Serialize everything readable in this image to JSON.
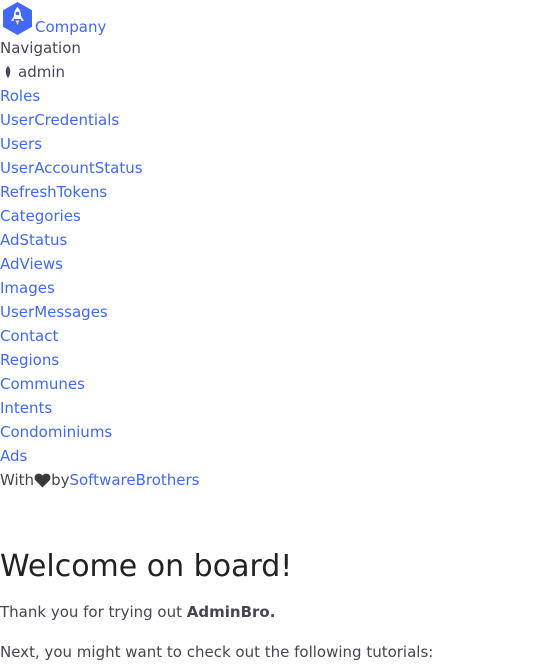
{
  "brand": {
    "logo_icon": "rocket-icon",
    "name": "Company"
  },
  "nav": {
    "heading": "Navigation",
    "group": {
      "icon": "leaf-icon",
      "label": "admin"
    },
    "items": [
      "Roles",
      "UserCredentials",
      "Users",
      "UserAccountStatus",
      "RefreshTokens",
      "Categories",
      "AdStatus",
      "AdViews",
      "Images",
      "UserMessages",
      "Contact",
      "Regions",
      "Communes",
      "Intents",
      "Condominiums",
      "Ads"
    ]
  },
  "footer": {
    "with": "With",
    "heart_icon": "heart-icon",
    "by": "by",
    "link": "SoftwareBrothers"
  },
  "welcome": {
    "title": "Welcome on board!",
    "thanks_prefix": "Thank you for trying out ",
    "product": "AdminBro.",
    "next": "Next, you might want to check out the following tutorials:"
  },
  "colors": {
    "link": "#4268f6",
    "logo_bg": "#4268f6",
    "text": "#454655"
  }
}
